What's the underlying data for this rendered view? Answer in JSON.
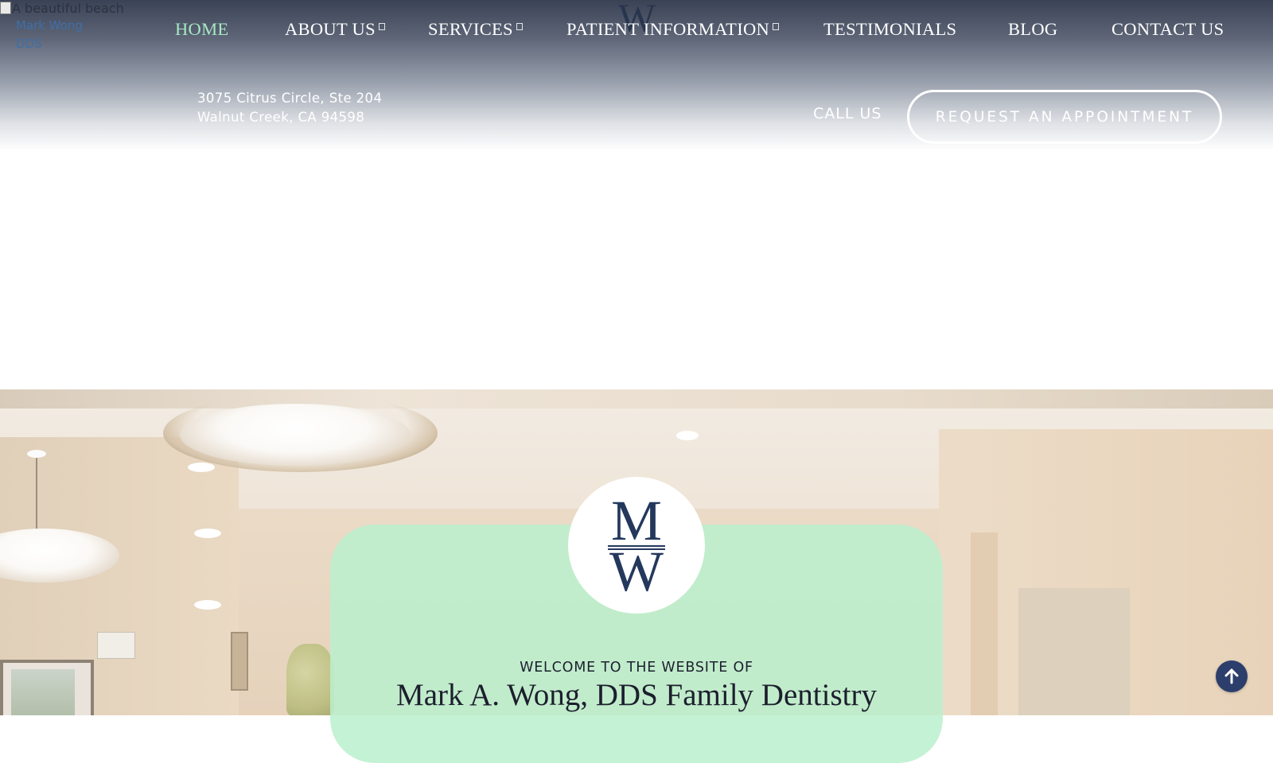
{
  "header": {
    "bg_image_alt": "A beautiful beach",
    "logo_alt": "Mark Wong DDS",
    "center_mark": "W",
    "nav": [
      {
        "label": "HOME",
        "active": true,
        "has_dropdown": false
      },
      {
        "label": "ABOUT US",
        "active": false,
        "has_dropdown": true
      },
      {
        "label": "SERVICES",
        "active": false,
        "has_dropdown": true
      },
      {
        "label": "PATIENT INFORMATION",
        "active": false,
        "has_dropdown": true
      },
      {
        "label": "TESTIMONIALS",
        "active": false,
        "has_dropdown": false
      },
      {
        "label": "BLOG",
        "active": false,
        "has_dropdown": false
      },
      {
        "label": "CONTACT US",
        "active": false,
        "has_dropdown": false
      }
    ],
    "address_line1": "3075 Citrus Circle, Ste 204",
    "address_line2": "Walnut Creek, CA 94598",
    "call_label": "CALL US",
    "appointment_label": "REQUEST AN APPOINTMENT"
  },
  "hero": {
    "logo_letters": {
      "top": "M",
      "bottom": "W"
    },
    "kicker": "WELCOME TO THE WEBSITE OF",
    "title": "Mark A. Wong, DDS Family Dentistry"
  },
  "colors": {
    "nav_active": "#a8e8c2",
    "card_green": "#baf0cd",
    "navy": "#24385c",
    "scroll_button": "#2c3e6b"
  },
  "icons": {
    "scroll_top": "arrow-up-icon",
    "dropdown": "chevron-down-icon"
  }
}
